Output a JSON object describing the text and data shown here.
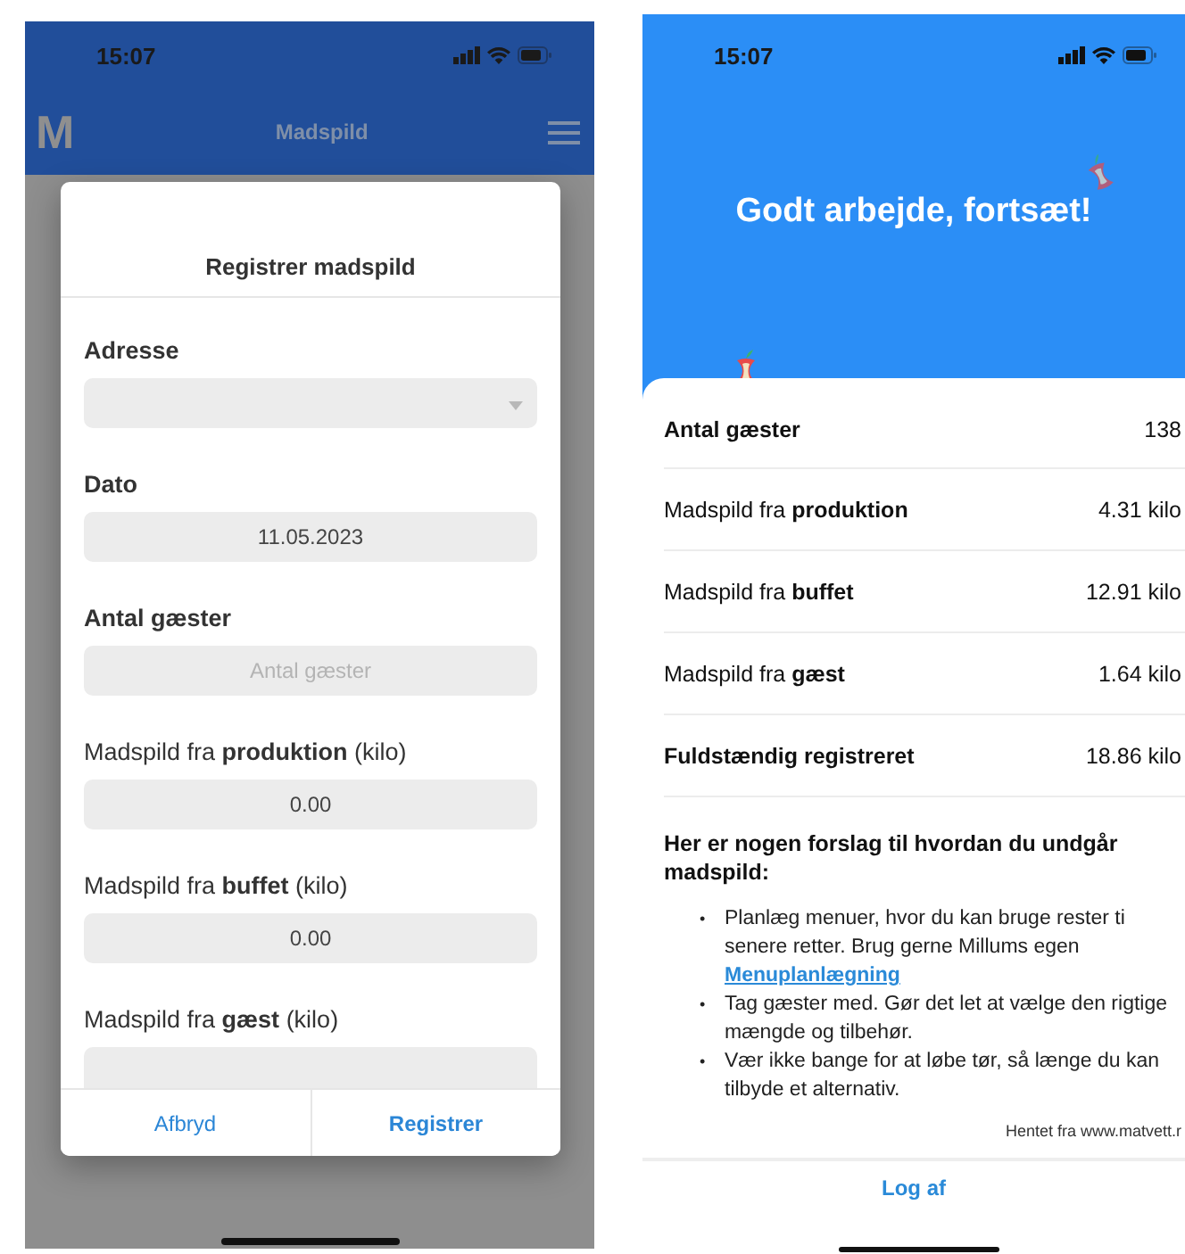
{
  "form_screen": {
    "status_bar": {
      "time": "15:07"
    },
    "app_bar": {
      "logo": "M",
      "title": "Madspild"
    },
    "dialog": {
      "title": "Registrer madspild",
      "fields": [
        {
          "label": "Adresse",
          "strong": true,
          "kind": "select"
        },
        {
          "label": "Dato",
          "strong": true,
          "kind": "input",
          "value": "11.05.2023"
        },
        {
          "label": "Antal gæster",
          "strong": true,
          "kind": "input",
          "placeholder": "Antal gæster"
        },
        {
          "label": "Madspild fra **produktion** (kilo)",
          "strong": false,
          "kind": "input",
          "value": "0.00"
        },
        {
          "label": "Madspild fra **buffet** (kilo)",
          "strong": false,
          "kind": "input",
          "value": "0.00"
        },
        {
          "label": "Madspild fra **gæst** (kilo)",
          "strong": false,
          "kind": "input"
        }
      ],
      "buttons": [
        {
          "label": "Afbryd",
          "primary": false
        },
        {
          "label": "Registrer",
          "primary": true
        }
      ]
    }
  },
  "summary_screen": {
    "status_bar": {
      "time": "15:07"
    },
    "headline": "Godt arbejde, fortsæt!",
    "stats": [
      {
        "label": "Antal gæster",
        "value": "138",
        "strong": true
      },
      {
        "label": "Madspild fra **produktion**",
        "value": "4.31 kilo",
        "strong": false
      },
      {
        "label": "Madspild fra **buffet**",
        "value": "12.91 kilo",
        "strong": false
      },
      {
        "label": "Madspild fra **gæst**",
        "value": "1.64 kilo",
        "strong": false
      },
      {
        "label": "Fuldstændig registreret",
        "value": "18.86 kilo",
        "strong": true
      }
    ],
    "tips_heading": "Her er nogen forslag til hvordan du undgår madspild:",
    "tips": [
      {
        "bullet": "•",
        "text": "Planlæg menuer, hvor du kan bruge rester ti senere retter. Brug gerne Millums egen",
        "link": "Menuplanlægning"
      },
      {
        "bullet": "•",
        "text": "Tag gæster med. Gør det let at vælge den rigtige mængde og tilbehør."
      },
      {
        "bullet": "•",
        "text": "Vær ikke bange for at løbe tør, så længe du kan tilbyde et alternativ."
      }
    ],
    "source": "Hentet fra www.matvett.r",
    "logout": "Log af"
  }
}
